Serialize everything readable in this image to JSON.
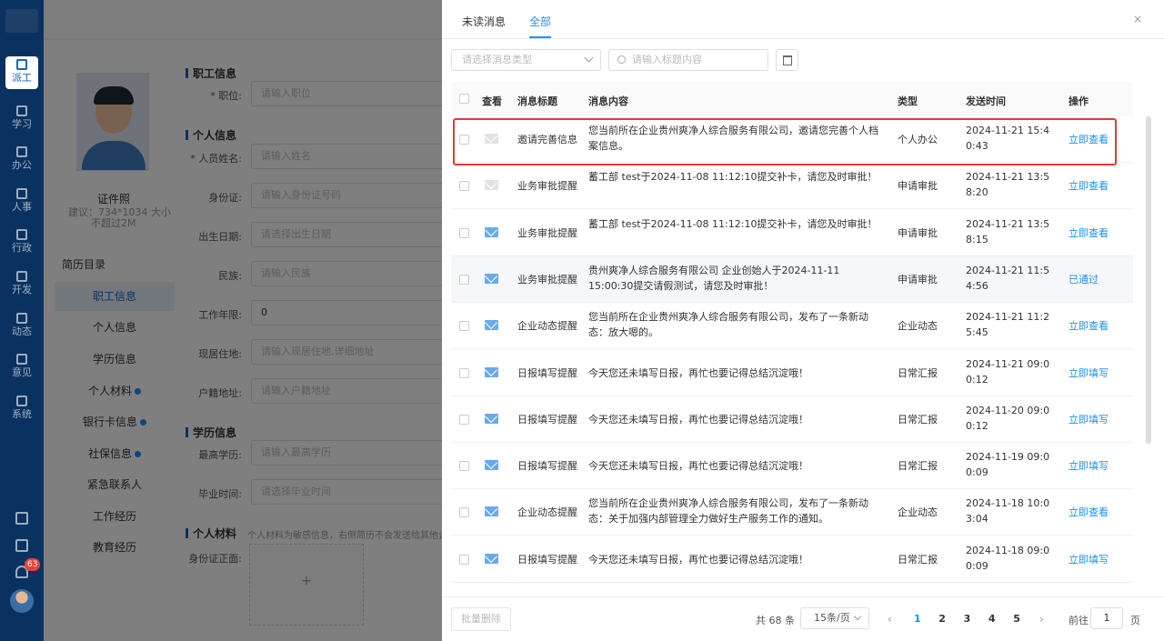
{
  "nav": {
    "items": [
      {
        "label": "派工",
        "icon": "dispatch-icon",
        "active": true
      },
      {
        "label": "学习",
        "icon": "book-icon"
      },
      {
        "label": "办公",
        "icon": "office-icon"
      },
      {
        "label": "人事",
        "icon": "personnel-icon"
      },
      {
        "label": "行政",
        "icon": "admin-icon"
      },
      {
        "label": "开发",
        "icon": "shield-icon"
      },
      {
        "label": "动态",
        "icon": "news-icon"
      },
      {
        "label": "意见",
        "icon": "feedback-icon"
      },
      {
        "label": "系统",
        "icon": "system-icon"
      }
    ],
    "bell_badge": "63"
  },
  "background": {
    "photo_label": "证件照",
    "photo_hint1": "建议：734*1034 大小",
    "photo_hint2": "不超过2M",
    "toc_title": "简历目录",
    "toc": [
      "职工信息",
      "个人信息",
      "学历信息",
      "个人材料",
      "银行卡信息",
      "社保信息",
      "紧急联系人",
      "工作经历",
      "教育经历"
    ],
    "sections": {
      "staff": "职工信息",
      "personal": "个人信息",
      "education": "学历信息",
      "materials": "个人材料"
    },
    "materials_hint": "个人材料为敏感信息，右侧简历不会发送给其他企业",
    "fields": {
      "position": {
        "label": "* 职位:",
        "placeholder": "请输入职位"
      },
      "name": {
        "label": "* 人员姓名:",
        "placeholder": "请输入姓名"
      },
      "idcard": {
        "label": "身份证:",
        "placeholder": "请输入身份证号码"
      },
      "birth": {
        "label": "出生日期:",
        "placeholder": "请选择出生日期"
      },
      "ethnic": {
        "label": "民族:",
        "placeholder": "请输入民族"
      },
      "years": {
        "label": "工作年限:",
        "value": "0"
      },
      "address": {
        "label": "现居住地:",
        "placeholder": "请输入现居住地,详细地址"
      },
      "hukou": {
        "label": "户籍地址:",
        "placeholder": "请输入户籍地址"
      },
      "degree": {
        "label": "最高学历:",
        "placeholder": "请输入最高学历"
      },
      "graduate": {
        "label": "毕业时间:",
        "placeholder": "请选择毕业时间"
      },
      "idfront": {
        "label": "身份证正面:"
      }
    },
    "upload_plus": "+"
  },
  "drawer": {
    "tabs": {
      "unread": "未读消息",
      "all": "全部"
    },
    "close_icon": "×",
    "type_select_placeholder": "请选择消息类型",
    "search_placeholder": "请输入标题内容",
    "columns": {
      "view": "查看",
      "title": "消息标题",
      "content": "消息内容",
      "type": "类型",
      "time": "发送时间",
      "action": "操作"
    },
    "rows": [
      {
        "read": true,
        "title": "邀请完善信息",
        "content": "您当前所在企业贵州爽净人综合服务有限公司，邀请您完善个人档案信息。",
        "type": "个人办公",
        "time": "2024-11-21 15:40:43",
        "action": "立即查看"
      },
      {
        "read": true,
        "title": "业务审批提醒",
        "content": "蓄工部 test于2024-11-08 11:12:10提交补卡，请您及时审批！",
        "type": "申请审批",
        "time": "2024-11-21 13:58:20",
        "action": "立即查看"
      },
      {
        "read": false,
        "title": "业务审批提醒",
        "content": "蓄工部 test于2024-11-08 11:12:10提交补卡，请您及时审批！",
        "type": "申请审批",
        "time": "2024-11-21 13:58:15",
        "action": "立即查看"
      },
      {
        "read": false,
        "title": "业务审批提醒",
        "content": "贵州爽净人综合服务有限公司 企业创始人于2024-11-11 15:00:30提交请假测试，请您及时审批！",
        "type": "申请审批",
        "time": "2024-11-21 11:54:56",
        "action": "已通过"
      },
      {
        "read": false,
        "title": "企业动态提醒",
        "content": "您当前所在企业贵州爽净人综合服务有限公司，发布了一条新动态：放大嗯的。",
        "type": "企业动态",
        "time": "2024-11-21 11:25:45",
        "action": "立即查看"
      },
      {
        "read": false,
        "title": "日报填写提醒",
        "content": "今天您还未填写日报，再忙也要记得总结沉淀哦！",
        "type": "日常汇报",
        "time": "2024-11-21 09:00:12",
        "action": "立即填写"
      },
      {
        "read": false,
        "title": "日报填写提醒",
        "content": "今天您还未填写日报，再忙也要记得总结沉淀哦！",
        "type": "日常汇报",
        "time": "2024-11-20 09:00:12",
        "action": "立即填写"
      },
      {
        "read": false,
        "title": "日报填写提醒",
        "content": "今天您还未填写日报，再忙也要记得总结沉淀哦！",
        "type": "日常汇报",
        "time": "2024-11-19 09:00:09",
        "action": "立即填写"
      },
      {
        "read": false,
        "title": "企业动态提醒",
        "content": "您当前所在企业贵州爽净人综合服务有限公司，发布了一条新动态：关于加强内部管理全力做好生产服务工作的通知。",
        "type": "企业动态",
        "time": "2024-11-18 10:03:04",
        "action": "立即查看"
      },
      {
        "read": false,
        "title": "日报填写提醒",
        "content": "今天您还未填写日报，再忙也要记得总结沉淀哦！",
        "type": "日常汇报",
        "time": "2024-11-18 09:00:09",
        "action": "立即填写"
      }
    ],
    "footer": {
      "batch_delete": "批量删除",
      "total": "共 68 条",
      "page_size": "15条/页",
      "pages": [
        "1",
        "2",
        "3",
        "4",
        "5"
      ],
      "current_page": "1",
      "goto_label": "前往",
      "goto_value": "1",
      "page_suffix": "页"
    }
  },
  "colors": {
    "accent": "#1890ff",
    "nav": "#1565c0",
    "highlight_box": "#e53935"
  }
}
